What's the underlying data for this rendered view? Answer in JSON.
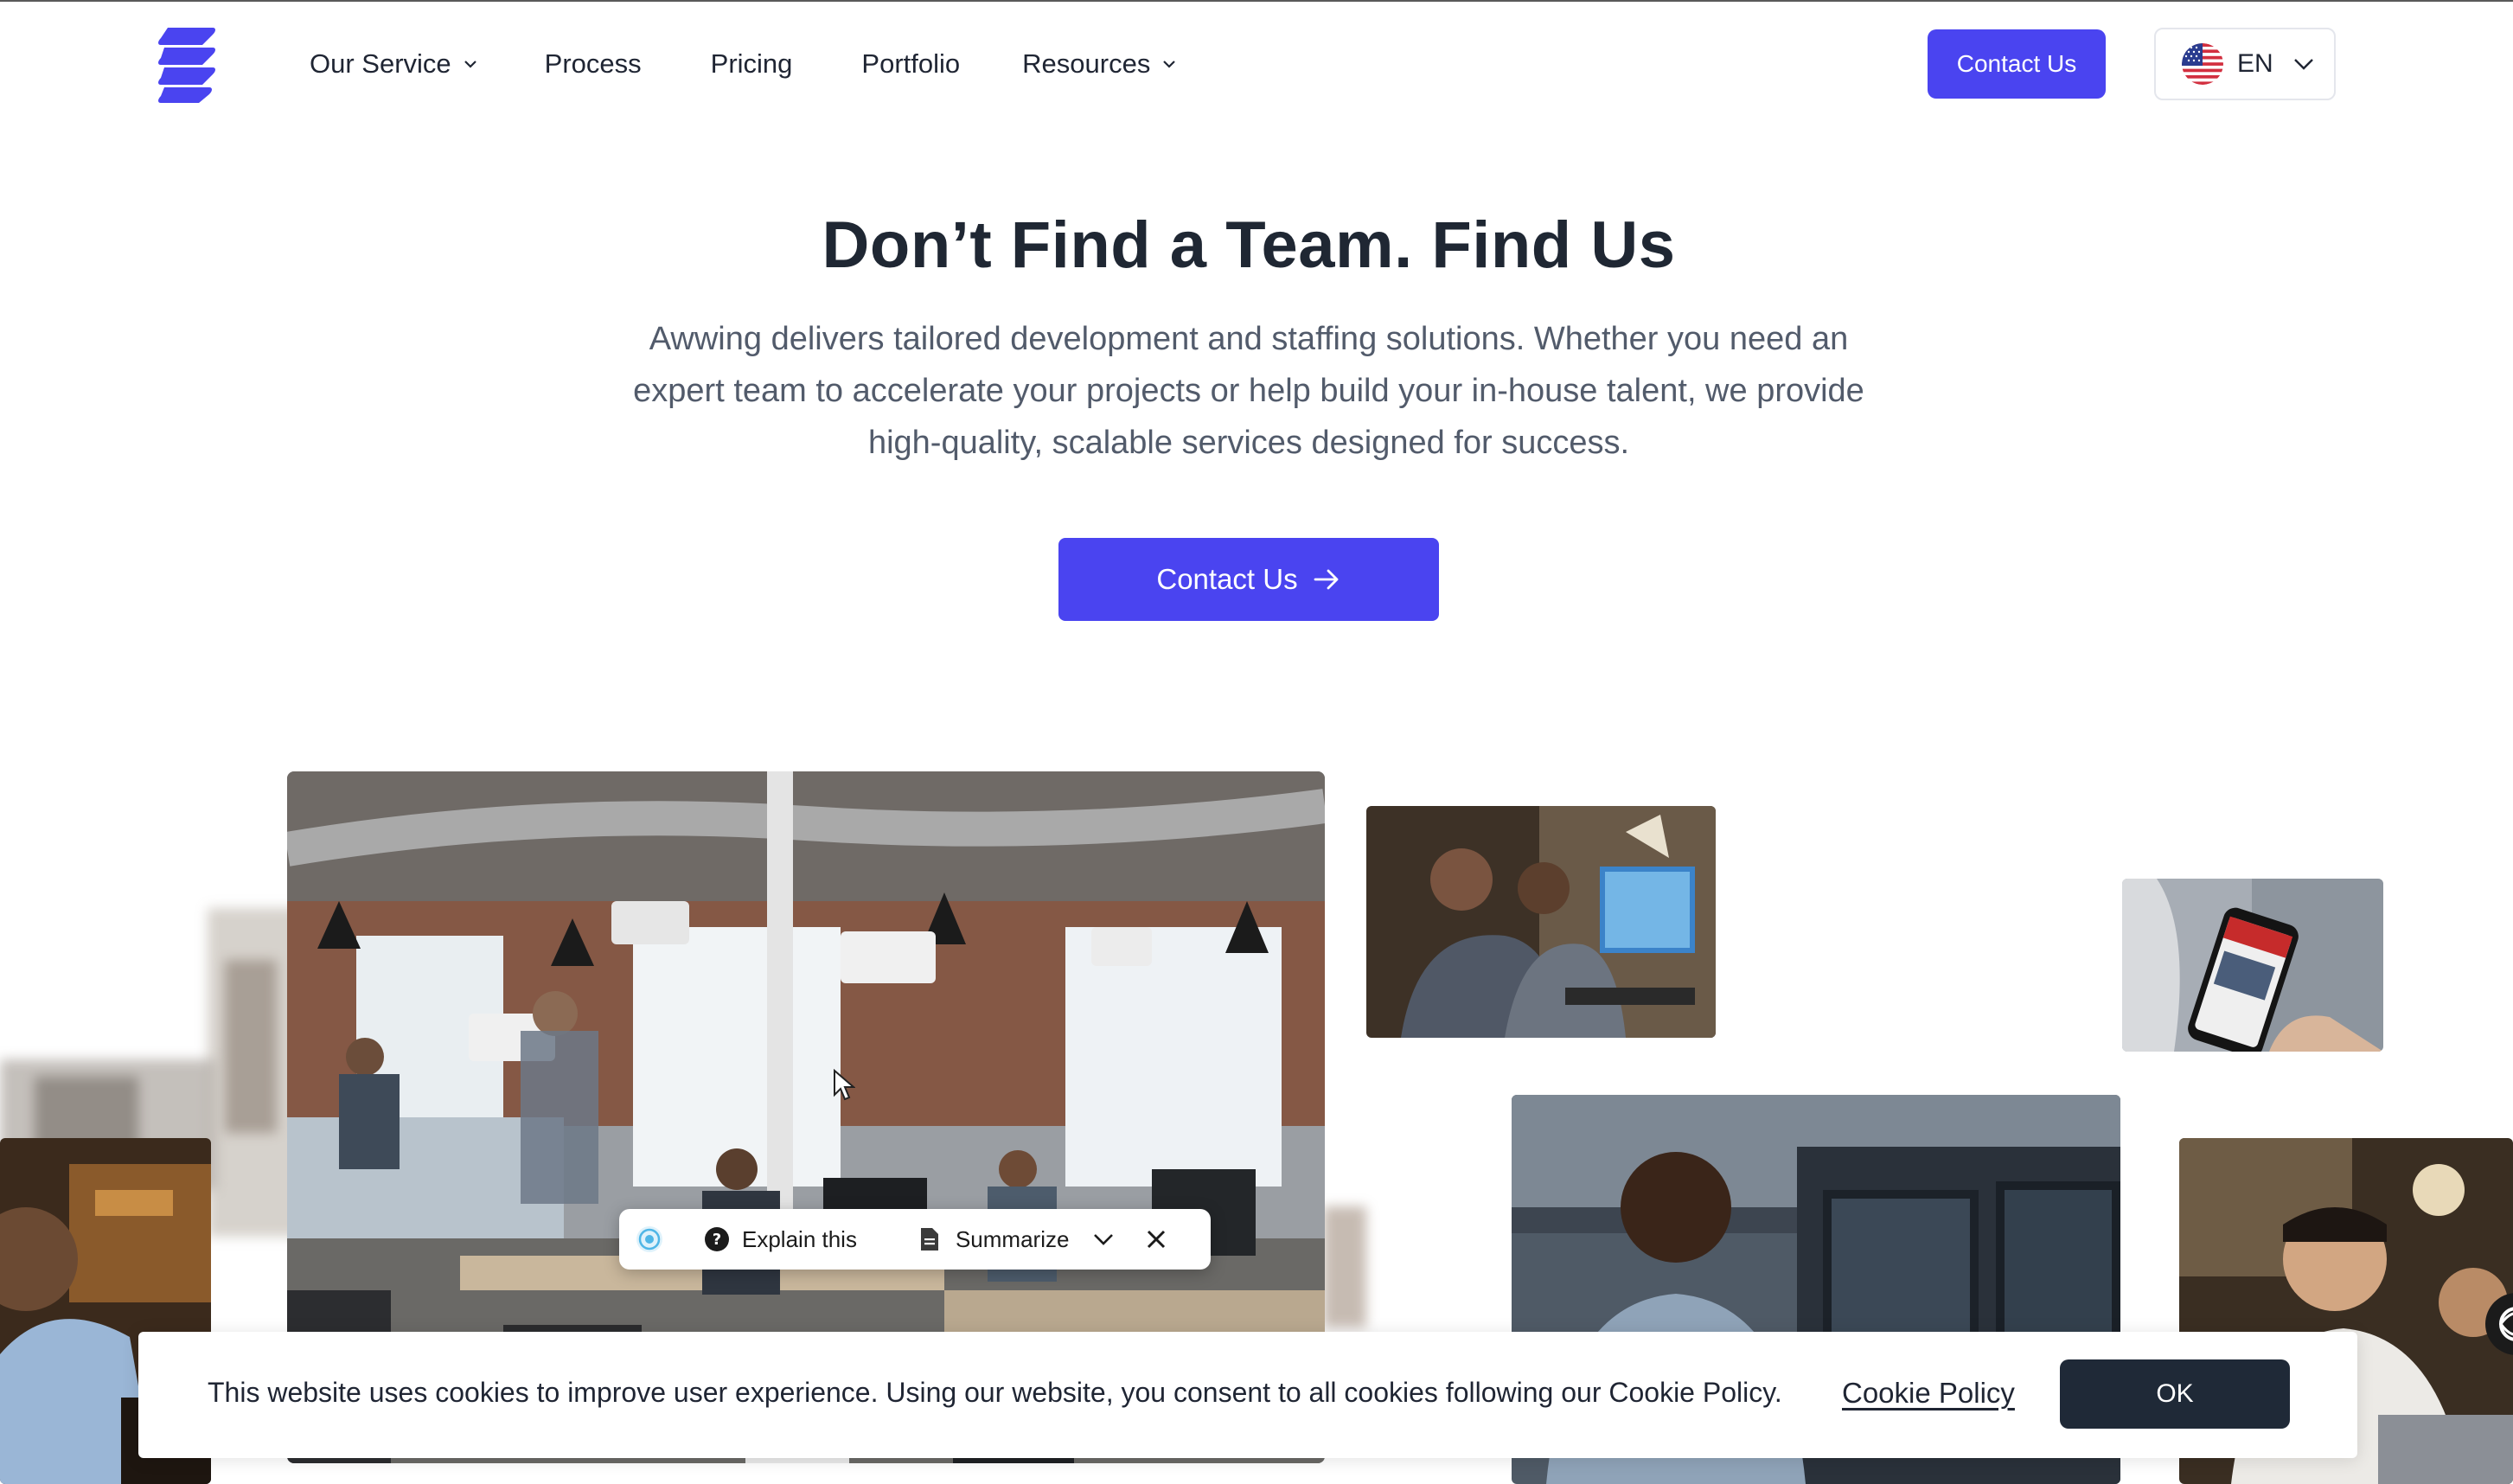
{
  "brand": {
    "logo_icon": "stacked-leaves-logo",
    "accent": "#4a44f0"
  },
  "nav": {
    "items": [
      {
        "label": "Our Service",
        "has_dropdown": true
      },
      {
        "label": "Process",
        "has_dropdown": false
      },
      {
        "label": "Pricing",
        "has_dropdown": false
      },
      {
        "label": "Portfolio",
        "has_dropdown": false
      },
      {
        "label": "Resources",
        "has_dropdown": true
      }
    ],
    "contact_label": "Contact Us",
    "language": {
      "code": "EN",
      "flag_icon": "us-flag-icon"
    }
  },
  "hero": {
    "title": "Don’t Find a Team. Find Us",
    "subtitle_lines": [
      "Awwing delivers tailored development and staffing solutions. Whether you need an",
      "expert team to accelerate your projects or help build your in-house talent, we provide",
      "high-quality, scalable services designed for success."
    ],
    "cta_label": "Contact Us"
  },
  "ai_toolbar": {
    "explain_label": "Explain this",
    "summarize_label": "Summarize"
  },
  "cookie_banner": {
    "text": "This website uses cookies to improve user experience. Using our website, you consent to all cookies following our Cookie Policy.",
    "link_label": "Cookie Policy",
    "ok_label": "OK"
  }
}
